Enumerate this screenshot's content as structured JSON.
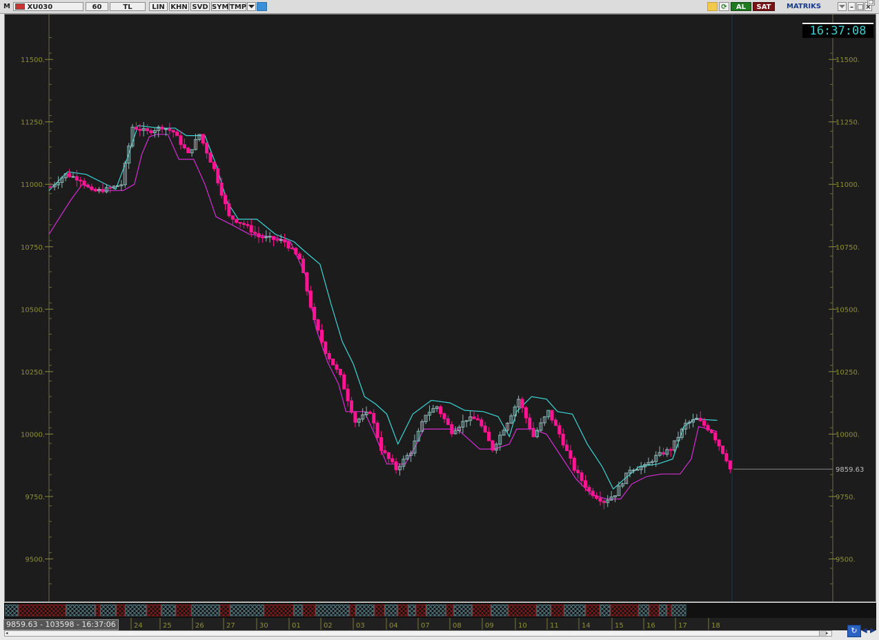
{
  "toolbar": {
    "menu_letter": "M",
    "symbol": "XU030",
    "period": "60",
    "currency": "TL",
    "buttons": [
      "LIN",
      "KHN",
      "SVD",
      "SYM",
      "TMP"
    ],
    "al": "AL",
    "sat": "SAT",
    "brand": "MATRIKS"
  },
  "clock": "16:37:08",
  "last_price_label": "9859.63",
  "readout": "9859.63 - 103598 - 16:37:06",
  "icons": {
    "menu": "m-icon",
    "symbol_flag": "flag-icon",
    "dropdown": "chevron-down-icon",
    "twitter": "twitter-bird-icon",
    "lightning": "lightning-icon",
    "refresh": "refresh-icon",
    "minimize": "minimize-icon",
    "maximize": "maximize-icon",
    "close": "close-icon",
    "restore": "restore-icon",
    "sync": "sync-icon",
    "arrow_left": "arrow-left-icon",
    "arrow_right": "arrow-right-icon"
  },
  "colors": {
    "background": "#1c1c1c",
    "candle_up": "#8fb9b9",
    "candle_down": "#ff1493",
    "band_upper": "#3cd7d7",
    "band_lower": "#d52ed5",
    "axis_label": "#8f8f3a",
    "clock_text": "#35d3d3",
    "al_bg": "#1f7a1f",
    "sat_bg": "#7a1414"
  },
  "chart_data": {
    "type": "candlestick",
    "y_ticks": [
      "11500.",
      "11250.",
      "11000.",
      "10750.",
      "10500.",
      "10250.",
      "10000.",
      "9750.",
      "9500."
    ],
    "y_tick_values": [
      11500,
      11250,
      11000,
      10750,
      10500,
      10250,
      10000,
      9750,
      9500
    ],
    "ylim": [
      9330,
      11680
    ],
    "x_ticks": [
      "24",
      "25",
      "26",
      "27",
      "30",
      "01",
      "02",
      "03",
      "04",
      "07",
      "08",
      "09",
      "10",
      "11",
      "14",
      "15",
      "16",
      "17",
      "18"
    ],
    "last_price": 9859.63,
    "close_path": [
      [
        0,
        10990
      ],
      [
        4,
        11040
      ],
      [
        8,
        11020
      ],
      [
        11,
        10970
      ],
      [
        15,
        10980
      ],
      [
        19,
        11000
      ],
      [
        22,
        11230
      ],
      [
        26,
        11210
      ],
      [
        30,
        11230
      ],
      [
        33,
        11210
      ],
      [
        37,
        11120
      ],
      [
        40,
        11200
      ],
      [
        44,
        11060
      ],
      [
        48,
        10870
      ],
      [
        52,
        10840
      ],
      [
        56,
        10790
      ],
      [
        60,
        10780
      ],
      [
        63,
        10770
      ],
      [
        67,
        10700
      ],
      [
        71,
        10450
      ],
      [
        74,
        10330
      ],
      [
        78,
        10230
      ],
      [
        82,
        10050
      ],
      [
        86,
        10090
      ],
      [
        89,
        9940
      ],
      [
        93,
        9860
      ],
      [
        97,
        9930
      ],
      [
        101,
        10080
      ],
      [
        104,
        10110
      ],
      [
        108,
        10010
      ],
      [
        112,
        10060
      ],
      [
        115,
        10060
      ],
      [
        119,
        9940
      ],
      [
        123,
        10050
      ],
      [
        126,
        10140
      ],
      [
        130,
        9990
      ],
      [
        134,
        10090
      ],
      [
        137,
        10000
      ],
      [
        141,
        9860
      ],
      [
        145,
        9770
      ],
      [
        149,
        9730
      ],
      [
        152,
        9760
      ],
      [
        156,
        9860
      ],
      [
        160,
        9870
      ],
      [
        163,
        9910
      ],
      [
        167,
        9940
      ],
      [
        171,
        10040
      ],
      [
        174,
        10060
      ],
      [
        178,
        10010
      ],
      [
        182,
        9900
      ],
      [
        183,
        9859.63
      ]
    ],
    "series": [
      {
        "name": "",
        "type": "line",
        "role": "upper-band",
        "points": [
          [
            0,
            10975
          ],
          [
            5,
            11050
          ],
          [
            10,
            11040
          ],
          [
            14,
            11010
          ],
          [
            18,
            10980
          ],
          [
            21,
            11100
          ],
          [
            24,
            11235
          ],
          [
            30,
            11225
          ],
          [
            34,
            11225
          ],
          [
            37,
            11195
          ],
          [
            42,
            11195
          ],
          [
            45,
            11080
          ],
          [
            48,
            10930
          ],
          [
            51,
            10860
          ],
          [
            56,
            10860
          ],
          [
            61,
            10800
          ],
          [
            66,
            10770
          ],
          [
            69,
            10730
          ],
          [
            73,
            10680
          ],
          [
            76,
            10520
          ],
          [
            79,
            10370
          ],
          [
            82,
            10280
          ],
          [
            85,
            10150
          ],
          [
            88,
            10120
          ],
          [
            91,
            10080
          ],
          [
            94,
            9960
          ],
          [
            98,
            10080
          ],
          [
            103,
            10135
          ],
          [
            108,
            10125
          ],
          [
            112,
            10095
          ],
          [
            117,
            10090
          ],
          [
            121,
            10070
          ],
          [
            124,
            9990
          ],
          [
            126,
            10090
          ],
          [
            130,
            10150
          ],
          [
            134,
            10140
          ],
          [
            137,
            10090
          ],
          [
            141,
            10080
          ],
          [
            145,
            9960
          ],
          [
            149,
            9870
          ],
          [
            152,
            9780
          ],
          [
            155,
            9820
          ],
          [
            159,
            9870
          ],
          [
            164,
            9880
          ],
          [
            168,
            9900
          ],
          [
            171,
            10030
          ],
          [
            174,
            10060
          ],
          [
            180,
            10055
          ]
        ]
      },
      {
        "name": "",
        "type": "line",
        "role": "lower-band",
        "points": [
          [
            0,
            10800
          ],
          [
            3,
            10870
          ],
          [
            6,
            10940
          ],
          [
            9,
            11000
          ],
          [
            12,
            10980
          ],
          [
            16,
            10975
          ],
          [
            20,
            10975
          ],
          [
            23,
            11000
          ],
          [
            25,
            11120
          ],
          [
            27,
            11190
          ],
          [
            29,
            11200
          ],
          [
            32,
            11200
          ],
          [
            35,
            11100
          ],
          [
            39,
            11100
          ],
          [
            42,
            11000
          ],
          [
            45,
            10870
          ],
          [
            49,
            10840
          ],
          [
            54,
            10800
          ],
          [
            60,
            10790
          ],
          [
            65,
            10770
          ],
          [
            69,
            10640
          ],
          [
            72,
            10420
          ],
          [
            75,
            10290
          ],
          [
            78,
            10200
          ],
          [
            80,
            10090
          ],
          [
            85,
            10090
          ],
          [
            88,
            9990
          ],
          [
            91,
            9880
          ],
          [
            96,
            9880
          ],
          [
            99,
            9960
          ],
          [
            101,
            10020
          ],
          [
            105,
            10020
          ],
          [
            110,
            10020
          ],
          [
            113,
            9980
          ],
          [
            116,
            9940
          ],
          [
            120,
            9940
          ],
          [
            124,
            9960
          ],
          [
            126,
            10020
          ],
          [
            130,
            10020
          ],
          [
            134,
            10000
          ],
          [
            138,
            9910
          ],
          [
            142,
            9820
          ],
          [
            146,
            9760
          ],
          [
            150,
            9740
          ],
          [
            154,
            9740
          ],
          [
            157,
            9800
          ],
          [
            161,
            9830
          ],
          [
            165,
            9840
          ],
          [
            170,
            9840
          ],
          [
            173,
            9900
          ],
          [
            175,
            10030
          ],
          [
            180,
            10010
          ]
        ]
      }
    ]
  }
}
